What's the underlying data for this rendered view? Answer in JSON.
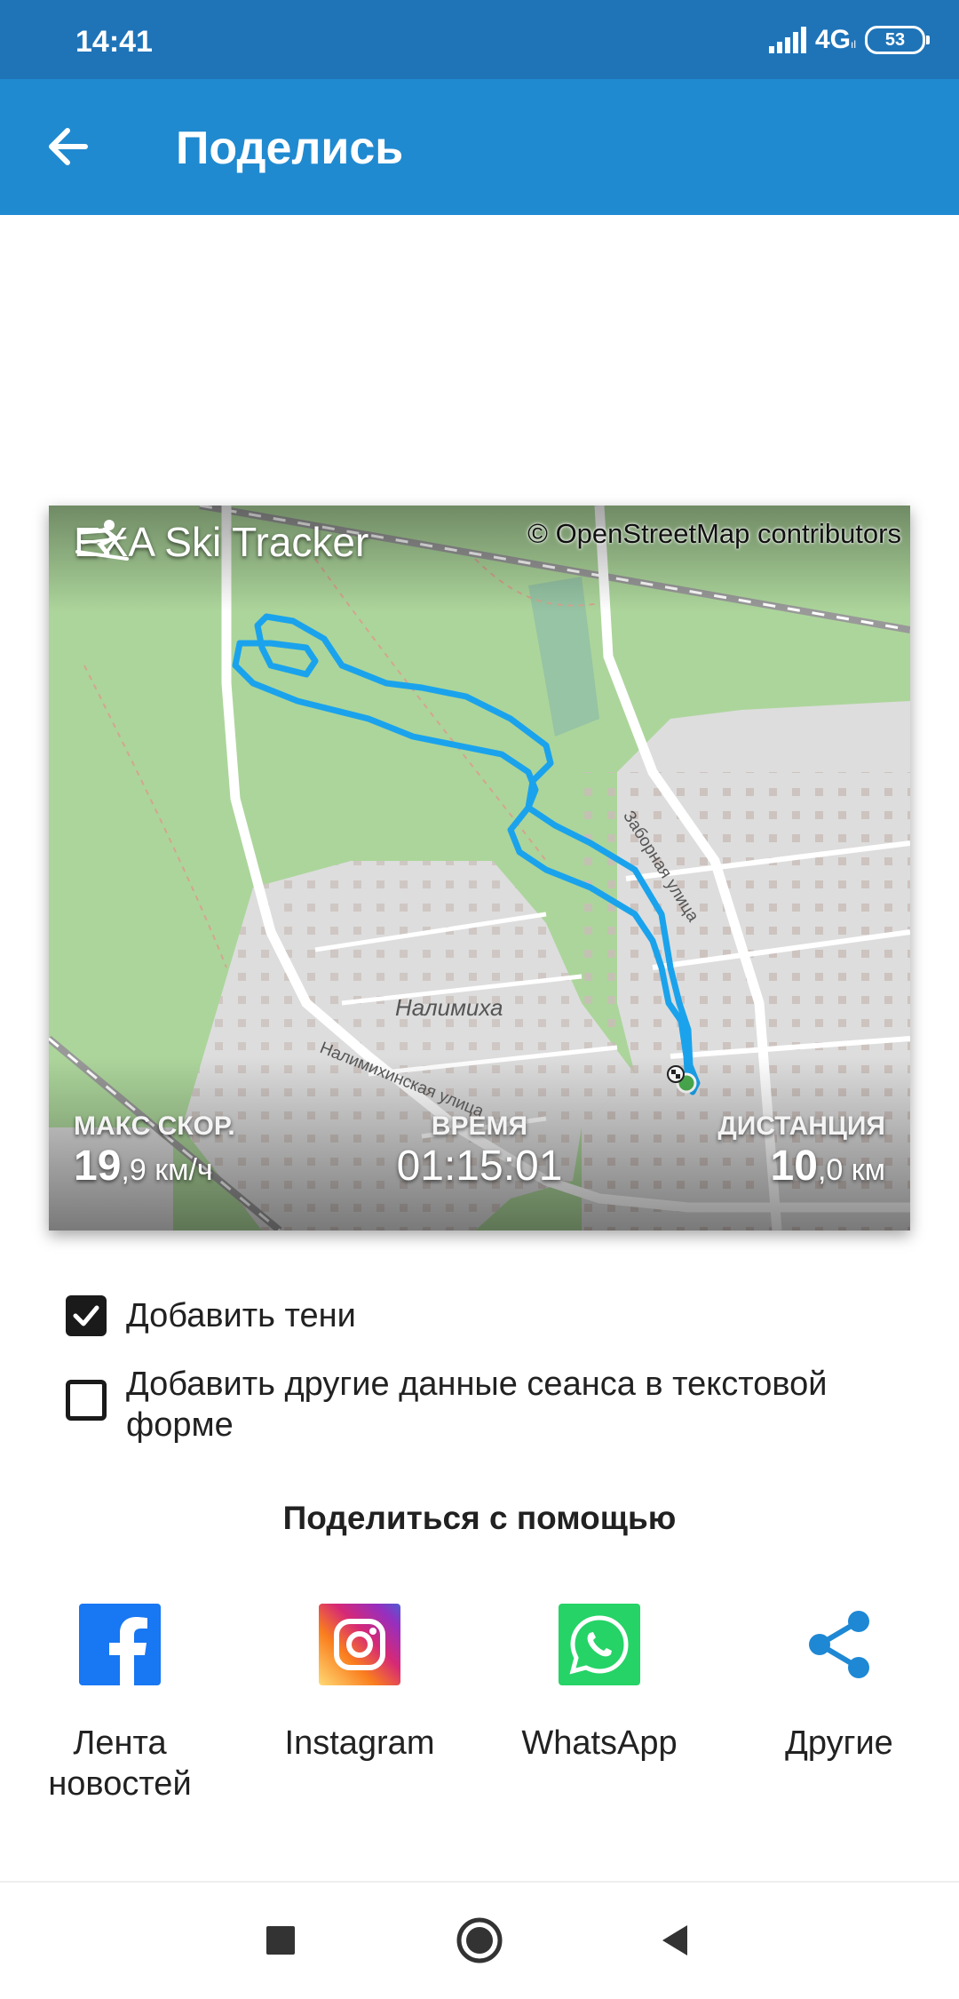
{
  "status_bar": {
    "time": "14:41",
    "network": "4G",
    "network_sub": "ıl",
    "battery": "53"
  },
  "app_bar": {
    "title": "Поделись"
  },
  "card": {
    "brand": "EXA Ski Tracker",
    "attribution": "© OpenStreetMap contributors",
    "map_labels": {
      "village": "Налимиха",
      "street1": "Налимихинская улица",
      "street2": "Заборная улица"
    },
    "stats": {
      "max_speed_label": "МАКС СКОР.",
      "max_speed_int": "19",
      "max_speed_rest": ",9 км/ч",
      "time_label": "ВРЕМЯ",
      "time_value": "01:15:01",
      "distance_label": "ДИСТАНЦИЯ",
      "distance_int": "10",
      "distance_rest": ",0 км"
    },
    "colors": {
      "track": "#1aa3ec",
      "forest": "#acd59b",
      "residential": "#dddddd"
    }
  },
  "options": [
    {
      "label": "Добавить тени",
      "checked": true
    },
    {
      "label": "Добавить другие данные сеанса в текстовой форме",
      "checked": false
    }
  ],
  "share": {
    "title": "Поделиться с помощью",
    "targets": [
      {
        "label": "Лента новостей",
        "icon": "facebook-icon"
      },
      {
        "label": "Instagram",
        "icon": "instagram-icon"
      },
      {
        "label": "WhatsApp",
        "icon": "whatsapp-icon"
      },
      {
        "label": "Другие",
        "icon": "share-icon"
      }
    ]
  }
}
